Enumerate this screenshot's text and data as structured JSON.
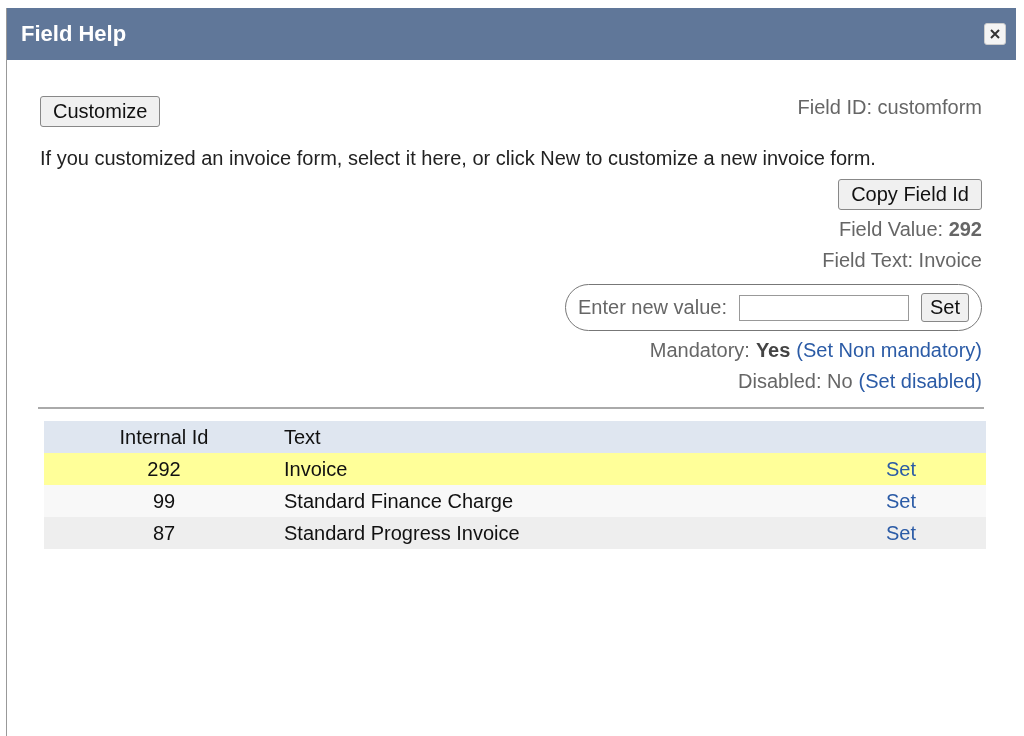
{
  "window": {
    "title": "Field Help"
  },
  "customize_button": "Customize",
  "field_id": "Field ID: customform",
  "description": "If you customized an invoice form, select it here, or click New to customize a new invoice form.",
  "copy_button": "Copy Field Id",
  "field_value": "Field Value: **292**",
  "field_text": "Field Text: Invoice",
  "new_value": {
    "label": "Enter new value:",
    "button": "Set"
  },
  "mandatory": {
    "label": "Mandatory:",
    "value": "Yes",
    "link": "(Set Non mandatory)"
  },
  "disabled": {
    "label": "Disabled: No",
    "link": "(Set disabled)"
  },
  "table": {
    "columns": [
      "Internal Id",
      "Text"
    ],
    "rows": [
      {
        "id": "292",
        "text": "Invoice",
        "action": "Set",
        "selected": true
      },
      {
        "id": "99",
        "text": "Standard Finance Charge",
        "action": "Set",
        "selected": false
      },
      {
        "id": "87",
        "text": "Standard Progress Invoice",
        "action": "Set",
        "selected": false
      }
    ]
  }
}
